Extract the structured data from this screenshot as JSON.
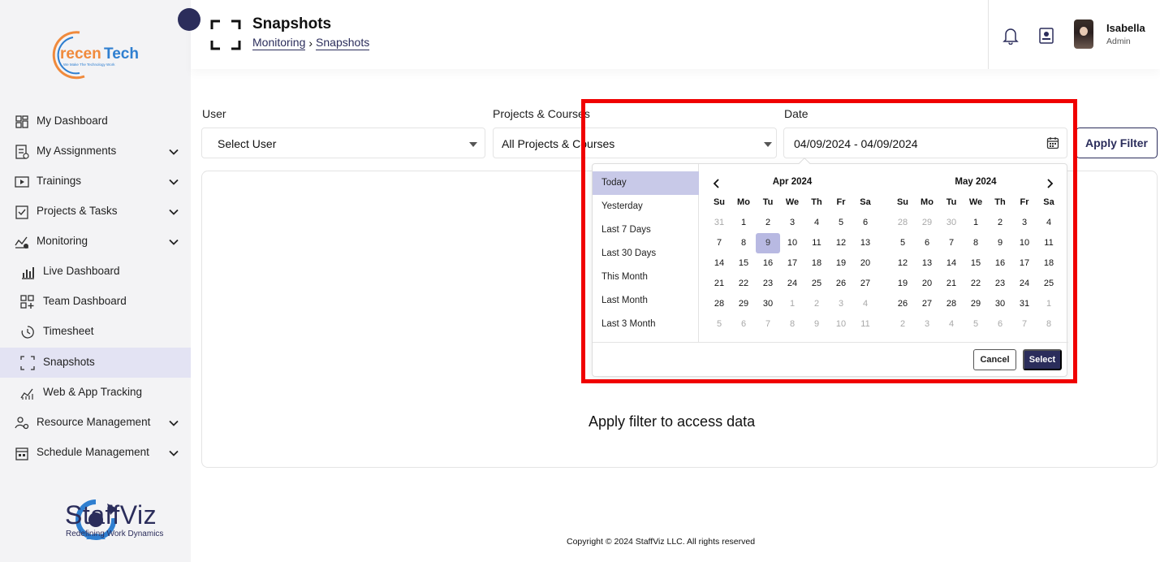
{
  "brand": {
    "logo_text": "recenTech",
    "logo_tagline": "We Make The Technology Work",
    "footer_name": "StaffViz",
    "footer_tagline": "Redefining Work Dynamics"
  },
  "sidebar": {
    "items": [
      {
        "label": "My Dashboard",
        "icon": "dashboard-icon",
        "expandable": false
      },
      {
        "label": "My Assignments",
        "icon": "assignments-icon",
        "expandable": true
      },
      {
        "label": "Trainings",
        "icon": "trainings-icon",
        "expandable": true
      },
      {
        "label": "Projects & Tasks",
        "icon": "projects-icon",
        "expandable": true
      },
      {
        "label": "Monitoring",
        "icon": "monitoring-icon",
        "expandable": true
      },
      {
        "label": "Live Dashboard",
        "icon": "bar-chart-icon",
        "sub": true
      },
      {
        "label": "Team Dashboard",
        "icon": "grid-plus-icon",
        "sub": true
      },
      {
        "label": "Timesheet",
        "icon": "clock-icon",
        "sub": true
      },
      {
        "label": "Snapshots",
        "icon": "snapshot-icon",
        "sub": true,
        "active": true
      },
      {
        "label": "Web & App Tracking",
        "icon": "tracking-icon",
        "sub": true
      },
      {
        "label": "Resource Management",
        "icon": "resource-icon",
        "expandable": true
      },
      {
        "label": "Schedule Management",
        "icon": "schedule-icon",
        "expandable": true
      }
    ]
  },
  "header": {
    "title": "Snapshots",
    "breadcrumb": [
      "Monitoring",
      "Snapshots"
    ],
    "breadcrumb_separator": "›",
    "user": {
      "name": "Isabella",
      "role": "Admin"
    }
  },
  "filters": {
    "user_label": "User",
    "user_value": "Select User",
    "projects_label": "Projects & Courses",
    "projects_value": "All Projects & Courses",
    "date_label": "Date",
    "date_value": "04/09/2024 - 04/09/2024",
    "apply_label": "Apply Filter"
  },
  "datepicker": {
    "ranges": [
      "Today",
      "Yesterday",
      "Last 7 Days",
      "Last 30 Days",
      "This Month",
      "Last Month",
      "Last 3 Month"
    ],
    "active_range": "Today",
    "weekdays": [
      "Su",
      "Mo",
      "Tu",
      "We",
      "Th",
      "Fr",
      "Sa"
    ],
    "months": [
      {
        "title": "Apr 2024",
        "days": [
          [
            "31",
            "off"
          ],
          [
            "1",
            ""
          ],
          [
            "2",
            ""
          ],
          [
            "3",
            ""
          ],
          [
            "4",
            ""
          ],
          [
            "5",
            ""
          ],
          [
            "6",
            ""
          ],
          [
            "7",
            ""
          ],
          [
            "8",
            ""
          ],
          [
            "9",
            "sel"
          ],
          [
            "10",
            ""
          ],
          [
            "11",
            ""
          ],
          [
            "12",
            ""
          ],
          [
            "13",
            ""
          ],
          [
            "14",
            ""
          ],
          [
            "15",
            ""
          ],
          [
            "16",
            ""
          ],
          [
            "17",
            ""
          ],
          [
            "18",
            ""
          ],
          [
            "19",
            ""
          ],
          [
            "20",
            ""
          ],
          [
            "21",
            ""
          ],
          [
            "22",
            ""
          ],
          [
            "23",
            ""
          ],
          [
            "24",
            ""
          ],
          [
            "25",
            ""
          ],
          [
            "26",
            ""
          ],
          [
            "27",
            ""
          ],
          [
            "28",
            ""
          ],
          [
            "29",
            ""
          ],
          [
            "30",
            ""
          ],
          [
            "1",
            "off"
          ],
          [
            "2",
            "off"
          ],
          [
            "3",
            "off"
          ],
          [
            "4",
            "off"
          ],
          [
            "5",
            "off"
          ],
          [
            "6",
            "off"
          ],
          [
            "7",
            "off"
          ],
          [
            "8",
            "off"
          ],
          [
            "9",
            "off"
          ],
          [
            "10",
            "off"
          ],
          [
            "11",
            "off"
          ]
        ]
      },
      {
        "title": "May 2024",
        "days": [
          [
            "28",
            "off"
          ],
          [
            "29",
            "off"
          ],
          [
            "30",
            "off"
          ],
          [
            "1",
            ""
          ],
          [
            "2",
            ""
          ],
          [
            "3",
            ""
          ],
          [
            "4",
            ""
          ],
          [
            "5",
            ""
          ],
          [
            "6",
            ""
          ],
          [
            "7",
            ""
          ],
          [
            "8",
            ""
          ],
          [
            "9",
            ""
          ],
          [
            "10",
            ""
          ],
          [
            "11",
            ""
          ],
          [
            "12",
            ""
          ],
          [
            "13",
            ""
          ],
          [
            "14",
            ""
          ],
          [
            "15",
            ""
          ],
          [
            "16",
            ""
          ],
          [
            "17",
            ""
          ],
          [
            "18",
            ""
          ],
          [
            "19",
            ""
          ],
          [
            "20",
            ""
          ],
          [
            "21",
            ""
          ],
          [
            "22",
            ""
          ],
          [
            "23",
            ""
          ],
          [
            "24",
            ""
          ],
          [
            "25",
            ""
          ],
          [
            "26",
            ""
          ],
          [
            "27",
            ""
          ],
          [
            "28",
            ""
          ],
          [
            "29",
            ""
          ],
          [
            "30",
            ""
          ],
          [
            "31",
            ""
          ],
          [
            "1",
            "off"
          ],
          [
            "2",
            "off"
          ],
          [
            "3",
            "off"
          ],
          [
            "4",
            "off"
          ],
          [
            "5",
            "off"
          ],
          [
            "6",
            "off"
          ],
          [
            "7",
            "off"
          ],
          [
            "8",
            "off"
          ]
        ]
      }
    ],
    "cancel_label": "Cancel",
    "select_label": "Select"
  },
  "content": {
    "empty_message": "Apply filter to access data"
  },
  "footer": {
    "copyright": "Copyright © 2024 StaffViz LLC. All rights reserved"
  },
  "colors": {
    "brand_navy": "#2b2d5b",
    "active_bg": "#e3e3f3",
    "highlight_red": "#f00000",
    "logo_orange": "#f08a3c",
    "logo_blue": "#2f7fd0"
  }
}
